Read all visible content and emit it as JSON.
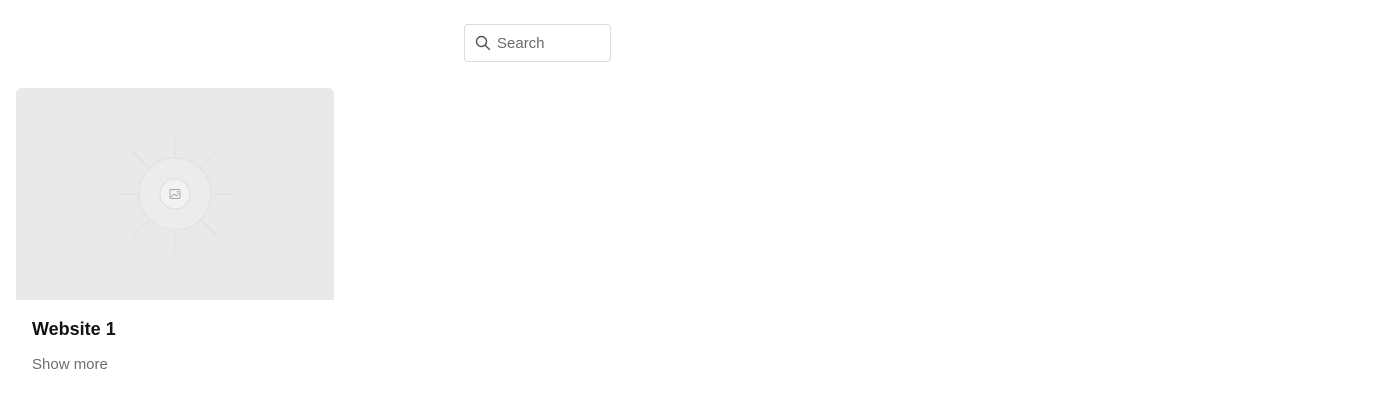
{
  "search": {
    "placeholder": "Search",
    "icon": "search-icon"
  },
  "cards": [
    {
      "title": "Website 1",
      "action_label": "Show more",
      "image_icon": "image-placeholder-icon"
    }
  ],
  "colors": {
    "card_image_bg": "#e9e9e9",
    "title_text": "#111111",
    "muted_text": "#6e6e6e",
    "border": "#dcdcdc"
  }
}
